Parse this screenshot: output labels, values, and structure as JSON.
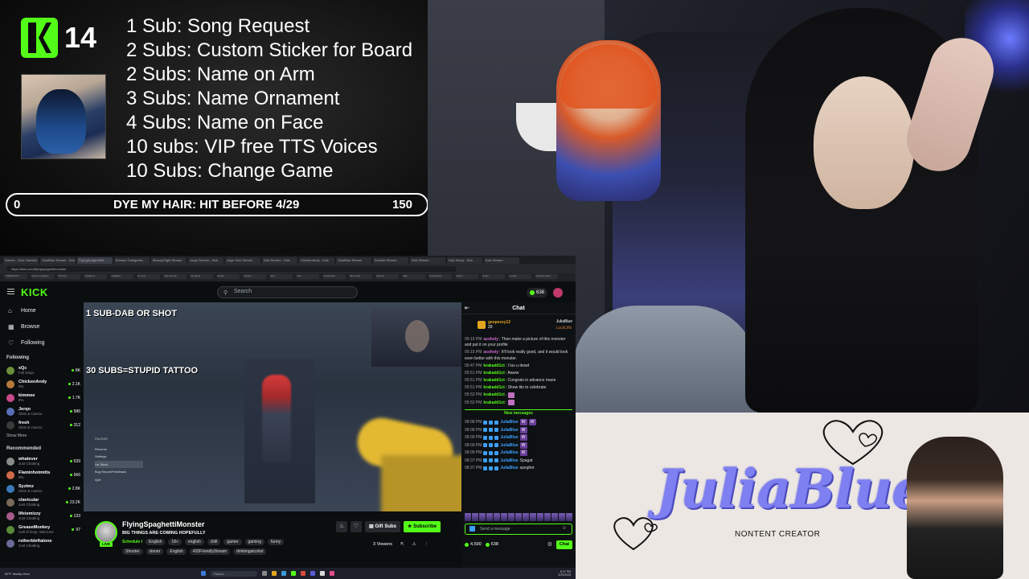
{
  "overlay": {
    "sub_count": "14",
    "goals": [
      "1 Sub: Song Request",
      "2 Subs: Custom Sticker for Board",
      "2 Subs: Name on Arm",
      "3 Subs: Name Ornament",
      "4 Subs: Name on Face",
      "10 subs: VIP free TTS Voices",
      "10 Subs: Change Game"
    ],
    "goal_bar": {
      "start": "0",
      "label": "DYE MY HAIR: HIT BEFORE 4/29",
      "end": "150"
    }
  },
  "banner": {
    "name": "JuliaBlue",
    "tagline": "NONTENT CREATOR"
  },
  "browser": {
    "tabs": [
      "Stream - Kick Clamber",
      "JuliaBlue Stream - Kick",
      "FlyingSpaghettiM...",
      "Browse Categories",
      "Beauty/Fight Stream",
      "Jorgo Stream - Kick",
      "Jeyje Kick Stream",
      "Kick Stream - Kick",
      "ChickenAndy - Kick",
      "JuliaBlue Stream",
      "Kickslie Stream",
      "Kick Stream",
      "Kick Setup - Kick",
      "Kick Stream"
    ],
    "url": "https://kick.com/flyingspaghettimonster",
    "bookmarks": [
      "TUBEBUDDY",
      "Stream Updates",
      "TIKTOK",
      "Instagram",
      "JuliaBlue",
      "Go Live",
      "Kick Stream",
      "My Ideas",
      "Reddit",
      "Plugins",
      "NKS",
      "Kick",
      "Streamlabs",
      "Blue stuff",
      "Discord",
      "Kick",
      "Dollarshave",
      "Twitch",
      "Dollar",
      "Current",
      "All Bookmarks"
    ]
  },
  "kick": {
    "wordmark": "KICK",
    "search_placeholder": "Search",
    "coins": "638",
    "nav": [
      {
        "icon": "home-icon",
        "label": "Home"
      },
      {
        "icon": "browse-icon",
        "label": "Browse"
      },
      {
        "icon": "heart-icon",
        "label": "Following"
      }
    ],
    "following_title": "Following",
    "following": [
      {
        "name": "xQc",
        "sub": "Full Disys",
        "viewers": "8K",
        "color": "#6b8f3a"
      },
      {
        "name": "ChickenAndy",
        "sub": "IRL",
        "viewers": "2.1K",
        "color": "#b87a3a"
      },
      {
        "name": "kimmee",
        "sub": "IRL",
        "viewers": "1.7K",
        "color": "#c84a8a"
      },
      {
        "name": "Jerqo",
        "sub": "Slots & Casino",
        "viewers": "586",
        "color": "#5a6fb8"
      },
      {
        "name": "fresh",
        "sub": "Slots & Casino",
        "viewers": "312",
        "color": "#3a3a3a"
      }
    ],
    "show_more": "Show More",
    "recommended_title": "Recommended",
    "recommended": [
      {
        "name": "whatever",
        "sub": "Just Chatting",
        "viewers": "539",
        "color": "#8a8a8a"
      },
      {
        "name": "Flaminhotmitts",
        "sub": "IRL",
        "viewers": "566",
        "color": "#d06a4a"
      },
      {
        "name": "Syztmz",
        "sub": "Slots & Casino",
        "viewers": "2.8K",
        "color": "#3a7ab8"
      },
      {
        "name": "clavicular",
        "sub": "Just Chatting",
        "viewers": "23.2K",
        "color": "#7a6a5a"
      },
      {
        "name": "lifeismizzy",
        "sub": "Just Chatting",
        "viewers": "133",
        "color": "#a85a8a"
      },
      {
        "name": "GreaseMonkey",
        "sub": "Call of Duty: Warzone",
        "viewers": "97",
        "color": "#5a8a3a"
      },
      {
        "name": "rstherbleftalone",
        "sub": "Just Chatting",
        "viewers": "",
        "color": "#6a6a9a"
      }
    ],
    "player": {
      "text1": "1 SUB-DAB OR SHOT",
      "text2": "30 SUBS=STUPID TATTOO",
      "pause_title": "PAUSED",
      "pause_items": [
        "Resume",
        "Settings",
        "I'm Stuck",
        "Bug Report/Feedback",
        "Quit"
      ]
    },
    "streamer": {
      "name": "FlyingSpaghettiMonster",
      "title": "BIG THINGS ARE COMING HOPEFULLY",
      "live": "LIVE",
      "category": "Schedule I",
      "tags1": [
        "English",
        "18+",
        "english",
        "chill",
        "gamer",
        "gaming",
        "funny"
      ],
      "tags2": [
        "Shooter",
        "stoner",
        "English",
        "420FriendlyStream",
        "drinkingalcohol"
      ],
      "gift_subs": "Gift Subs",
      "subscribe": "Subscribe",
      "viewers": "3 Viewers",
      "uptime": "00:00:00"
    },
    "chat": {
      "title": "Chat",
      "gift": {
        "user": "geepeezy12",
        "count": "20",
        "top1": "JuliaBlue",
        "top2": "LuckLifts"
      },
      "messages": [
        {
          "time": "05:15 PM",
          "user": "assholy",
          "color": "#d06ad0",
          "text": "Then make a picture of this monster and put it on your profile"
        },
        {
          "time": "05:15 PM",
          "user": "assholy",
          "color": "#d06ad0",
          "text": "It'll look really good, and it would look even better with this monster."
        },
        {
          "time": "05:47 PM",
          "user": "krakadd1ct",
          "color": "#53fc18",
          "text": "I luv u dewd"
        },
        {
          "time": "05:51 PM",
          "user": "krakadd1ct",
          "color": "#53fc18",
          "text": "Awww"
        },
        {
          "time": "05:51 PM",
          "user": "krakadd1ct",
          "color": "#53fc18",
          "text": "Congrats in advance mane"
        },
        {
          "time": "05:51 PM",
          "user": "krakadd1ct",
          "color": "#53fc18",
          "text": "Show tits to celebrate"
        },
        {
          "time": "05:52 PM",
          "user": "krakadd1ct",
          "color": "#53fc18",
          "text": ""
        },
        {
          "time": "05:52 PM",
          "user": "krakadd1ct",
          "color": "#53fc18",
          "text": ""
        }
      ],
      "new_messages": "New messages",
      "w_rows": [
        {
          "time": "08:08 PM",
          "user": "JuliaBlue",
          "text": "",
          "w": 2
        },
        {
          "time": "08:08 PM",
          "user": "JuliaBlue",
          "text": "",
          "w": 1
        },
        {
          "time": "08:09 PM",
          "user": "JuliaBlue",
          "text": "",
          "w": 1
        },
        {
          "time": "08:09 PM",
          "user": "JuliaBlue",
          "text": "",
          "w": 1
        },
        {
          "time": "08:09 PM",
          "user": "JuliaBlue",
          "text": "",
          "w": 1
        },
        {
          "time": "08:37 PM",
          "user": "JuliaBlue",
          "text": "Spagat",
          "w": 0
        },
        {
          "time": "08:37 PM",
          "user": "JuliaBlue",
          "text": "speghet",
          "w": 0
        }
      ],
      "input_placeholder": "Send a message",
      "balance1": "4,590",
      "balance2": "638",
      "chat_button": "Chat"
    }
  },
  "taskbar": {
    "weather": "65°F Mostly clear",
    "search": "Search",
    "time": "8:37 PM",
    "date": "3/29/2025"
  }
}
